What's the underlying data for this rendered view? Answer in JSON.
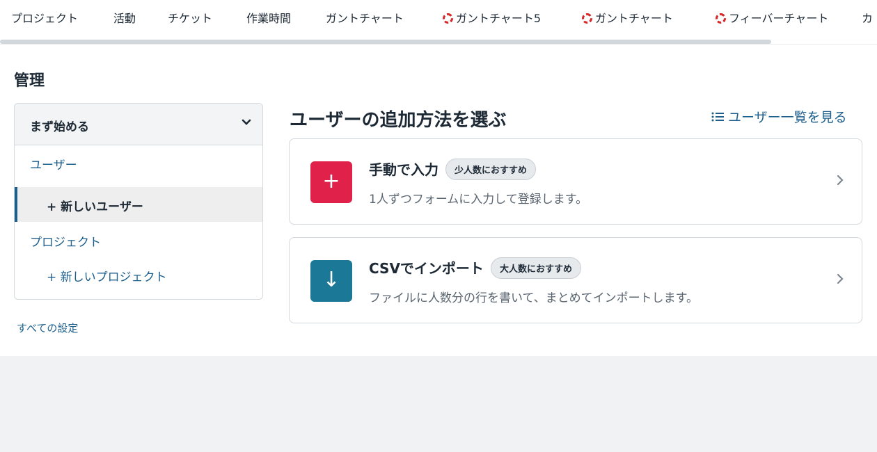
{
  "topnav": {
    "tabs": [
      {
        "label": "プロジェクト",
        "icon": ""
      },
      {
        "label": "活動",
        "icon": ""
      },
      {
        "label": "チケット",
        "icon": ""
      },
      {
        "label": "作業時間",
        "icon": ""
      },
      {
        "label": "ガントチャート",
        "icon": ""
      },
      {
        "label": "ガントチャート5",
        "icon": "spinner-icon"
      },
      {
        "label": "ガントチャート",
        "icon": "spinner-icon"
      },
      {
        "label": "フィーバーチャート",
        "icon": "spinner-icon"
      },
      {
        "label": "カ",
        "icon": ""
      }
    ]
  },
  "page": {
    "title": "管理"
  },
  "sidebar": {
    "header": "まず始める",
    "chevron": "⌄",
    "items": [
      {
        "label": "ユーザー",
        "active": false
      },
      {
        "label": "+ 新しいユーザー",
        "active": true
      },
      {
        "label": "プロジェクト",
        "active": false
      },
      {
        "label": "+ 新しいプロジェクト",
        "active": false
      }
    ],
    "all_settings": "すべての設定"
  },
  "content": {
    "title": "ユーザーの追加方法を選ぶ",
    "list_link": "ユーザー一覧を見る",
    "list_icon": "list-icon",
    "cards": [
      {
        "title": "手動で入力",
        "badge": "少人数におすすめ",
        "desc": "1人ずつフォームに入力して登録します。",
        "icon": "plus-icon",
        "icon_glyph": "+",
        "color": "#e0224a"
      },
      {
        "title": "CSVでインポート",
        "badge": "大人数におすすめ",
        "desc": "ファイルに人数分の行を書いて、まとめてインポートします。",
        "icon": "download-arrow-icon",
        "icon_glyph": "↓",
        "color": "#1b7896"
      }
    ],
    "chevron": "›"
  }
}
